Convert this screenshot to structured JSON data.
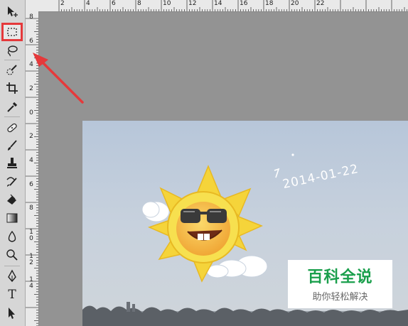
{
  "ruler_top": {
    "labels": [
      "2",
      "4",
      "6",
      "8",
      "10",
      "12",
      "14",
      "16",
      "18",
      "20",
      "22"
    ]
  },
  "ruler_left": {
    "labels": [
      "8",
      "6",
      "4",
      "2",
      "0",
      "2",
      "4",
      "6",
      "8",
      "1\n0",
      "1\n2",
      "1\n4"
    ]
  },
  "toolbar": {
    "tools": [
      "move-tool",
      "rectangular-marquee-tool",
      "lasso-tool",
      "quick-selection-tool",
      "crop-tool",
      "eyedropper-tool",
      "spot-healing-brush-tool",
      "brush-tool",
      "clone-stamp-tool",
      "history-brush-tool",
      "eraser-tool",
      "gradient-tool",
      "blur-tool",
      "dodge-tool",
      "pen-tool",
      "type-tool",
      "path-selection-tool"
    ],
    "type_label": "T"
  },
  "photo": {
    "date_stamp": "2014-01-22",
    "watermark_main": "百科全说",
    "watermark_sub": "助你轻松解决"
  },
  "colors": {
    "highlight": "#e5393b",
    "watermark_green": "#1a9f4c"
  }
}
